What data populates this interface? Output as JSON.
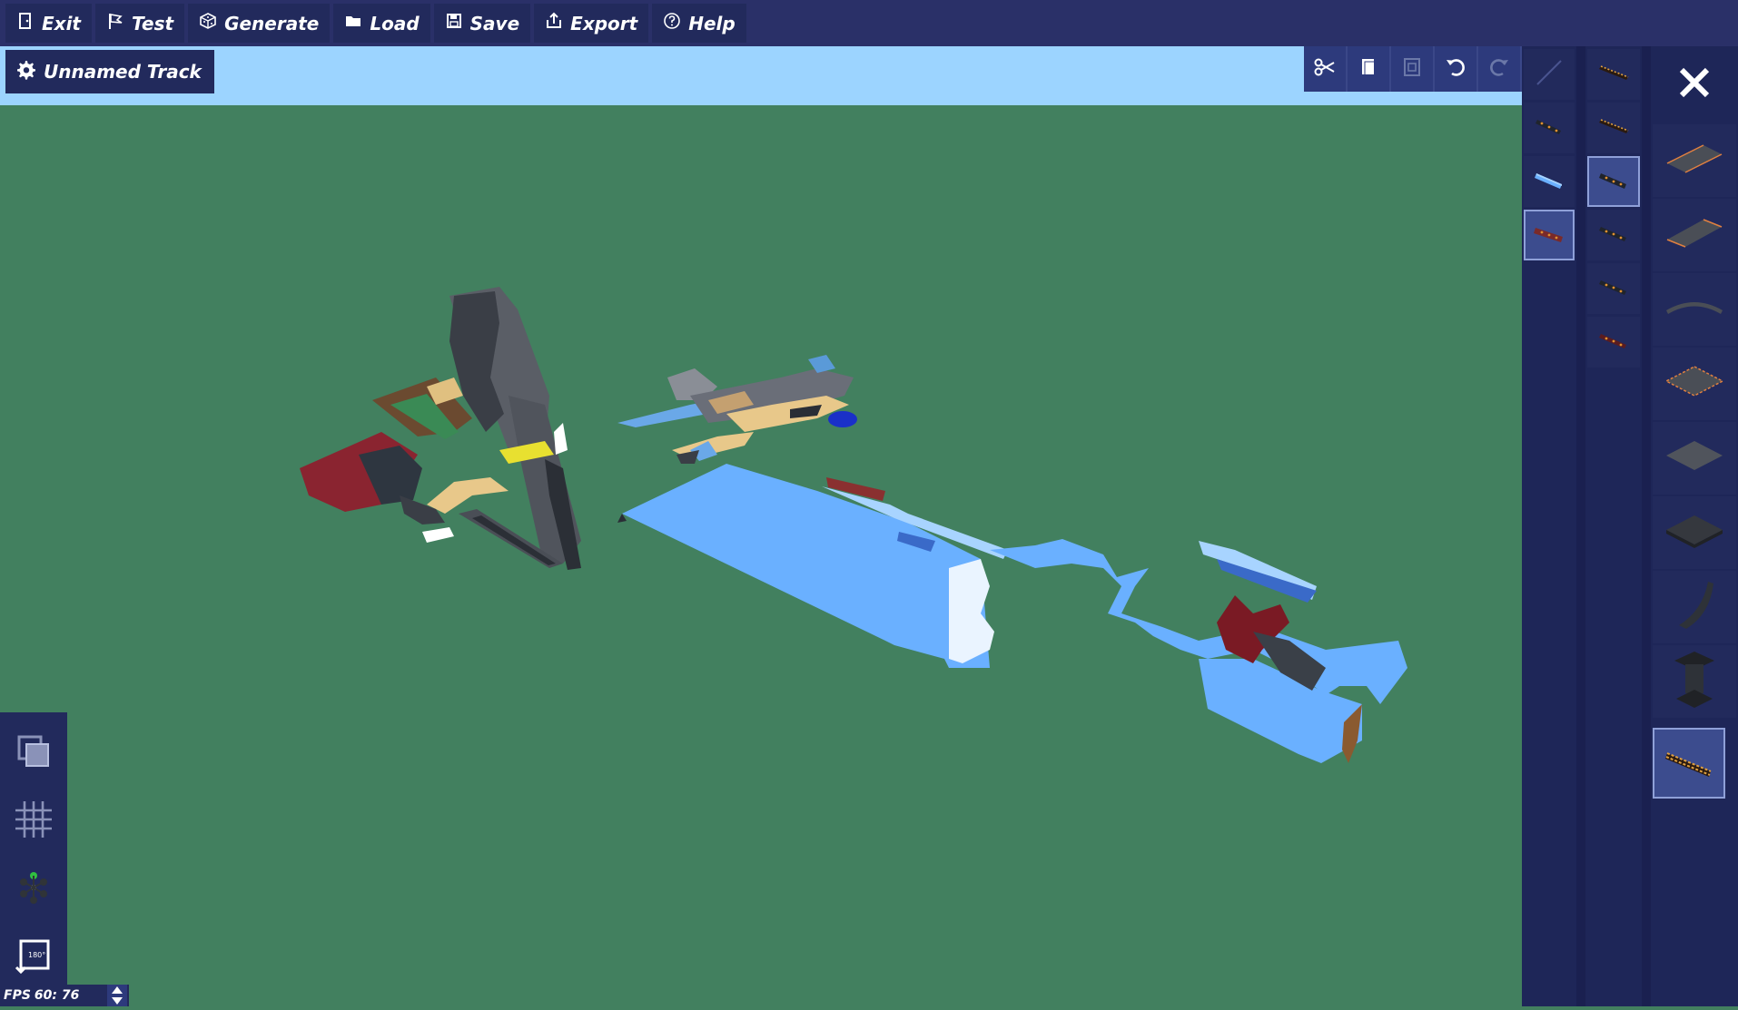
{
  "menu": {
    "items": [
      {
        "label": "Exit",
        "icon": "door-icon"
      },
      {
        "label": "Test",
        "icon": "flag-icon"
      },
      {
        "label": "Generate",
        "icon": "dice-icon"
      },
      {
        "label": "Load",
        "icon": "folder-icon"
      },
      {
        "label": "Save",
        "icon": "floppy-icon"
      },
      {
        "label": "Export",
        "icon": "share-icon"
      },
      {
        "label": "Help",
        "icon": "question-icon"
      }
    ]
  },
  "track": {
    "name": "Unnamed Track",
    "icon": "gear-icon"
  },
  "toolbar": {
    "tools": [
      "scissors-icon",
      "copy-icon",
      "paste-icon",
      "undo-icon",
      "redo-icon"
    ]
  },
  "left_tools": [
    "layers-icon",
    "grid-icon",
    "gizmo-icon",
    "rotate-icon"
  ],
  "status": {
    "fps_label": "FPS",
    "fps_value": "60: 76"
  },
  "palette": {
    "column1": [
      "diagonal-line-icon",
      "barrier-piece-icon",
      "blue-ramp-piece-icon",
      "red-barrier-piece-icon"
    ],
    "column1_selected": 3,
    "column2": [
      "striped-barrier-icon",
      "striped-barrier-icon",
      "barrier-piece-icon",
      "barrier-piece-icon",
      "barrier-piece-icon",
      "red-barrier-piece-icon"
    ],
    "column2_selected": 2,
    "column3": [
      "flat-tile-icon",
      "tilted-tile-icon",
      "curved-arc-icon",
      "bordered-tile-icon",
      "plain-tile-icon",
      "dark-tile-icon",
      "curved-ramp-icon",
      "pillar-icon",
      "striped-barrier-icon"
    ],
    "column3_selected": 8
  },
  "colors": {
    "background": "#42805f",
    "topbar": "#2a3068",
    "button": "#222a5c",
    "subbar": "#9cd4ff"
  }
}
